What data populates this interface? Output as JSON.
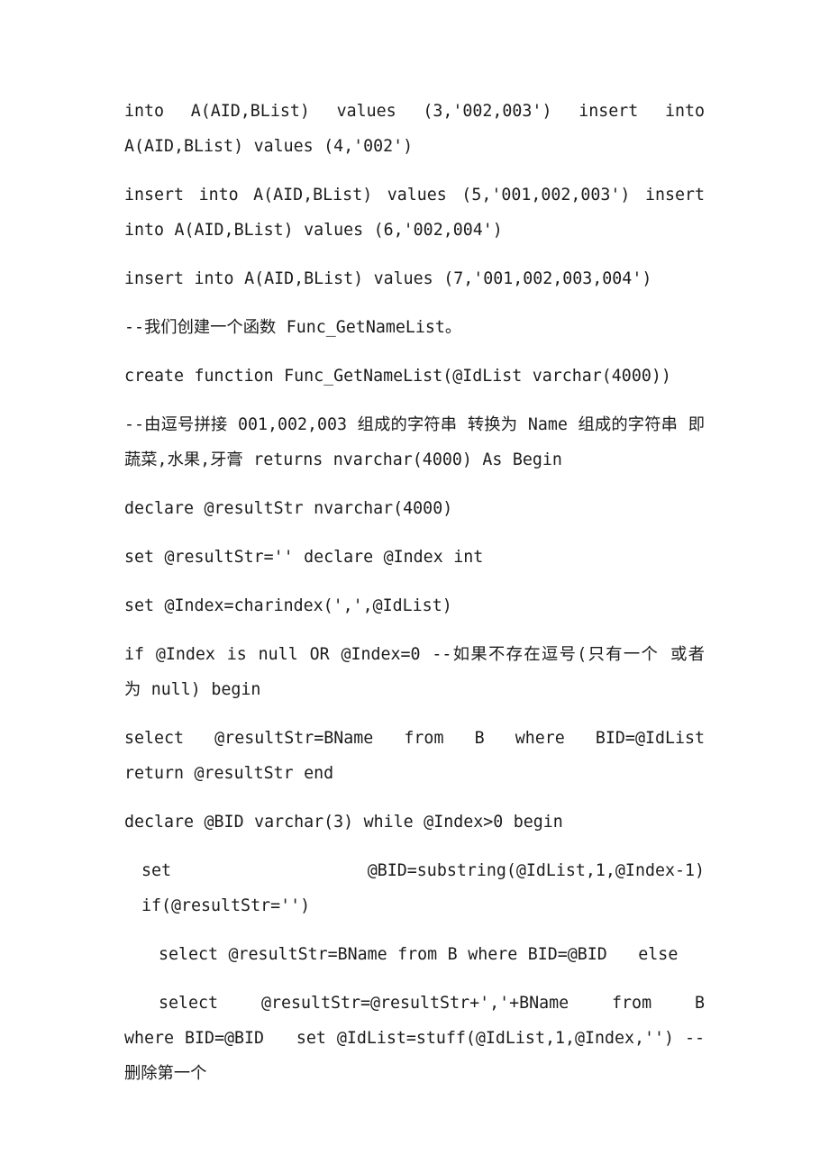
{
  "document": {
    "page_background": "#ffffff",
    "text_color": "#1c1c1c",
    "page_number_visible": false,
    "paragraphs": [
      {
        "id": "p1",
        "style": "justified",
        "text": "into A(AID,BList) values (3,'002,003') insert into A(AID,BList) values (4,'002')"
      },
      {
        "id": "p2",
        "style": "justified",
        "text": "insert into A(AID,BList) values (5,'001,002,003') insert into A(AID,BList) values (6,'002,004')"
      },
      {
        "id": "p3",
        "style": "justified",
        "text": "insert into A(AID,BList) values (7,'001,002,003,004')"
      },
      {
        "id": "p4",
        "style": "justified",
        "text": "--我们创建一个函数 Func_GetNameList。"
      },
      {
        "id": "p5",
        "style": "justified",
        "text": "create function Func_GetNameList(@IdList varchar(4000))"
      },
      {
        "id": "p6",
        "style": "justified",
        "text": "--由逗号拼接 001,002,003 组成的字符串 转换为 Name 组成的字符串 即 蔬菜,水果,牙膏 returns nvarchar(4000) As Begin"
      },
      {
        "id": "p7",
        "style": "justified",
        "text": "declare @resultStr nvarchar(4000)"
      },
      {
        "id": "p8",
        "style": "justified",
        "text": "set @resultStr='' declare @Index int"
      },
      {
        "id": "p9",
        "style": "justified",
        "text": "set @Index=charindex(',',@IdList)"
      },
      {
        "id": "p10",
        "style": "justified",
        "text": "if @Index is null OR @Index=0 --如果不存在逗号(只有一个 或者 为 null) begin"
      },
      {
        "id": "p11",
        "style": "justified",
        "text": "select  @resultStr=BName  from  B  where  BID=@IdList  return @resultStr end"
      },
      {
        "id": "p12",
        "style": "justified",
        "text": "declare @BID varchar(3) while @Index>0 begin"
      },
      {
        "id": "p13",
        "style": "indent1",
        "text": "set @BID=substring(@IdList,1,@Index-1)   if(@resultStr='')"
      },
      {
        "id": "p14",
        "style": "indent2",
        "text": "select @resultStr=BName from B where BID=@BID   else"
      },
      {
        "id": "p15",
        "style": "hang2",
        "text": "select   @resultStr=@resultStr+','+BName   from   B   where BID=@BID   set @IdList=stuff(@IdList,1,@Index,'') --删除第一个"
      }
    ]
  }
}
